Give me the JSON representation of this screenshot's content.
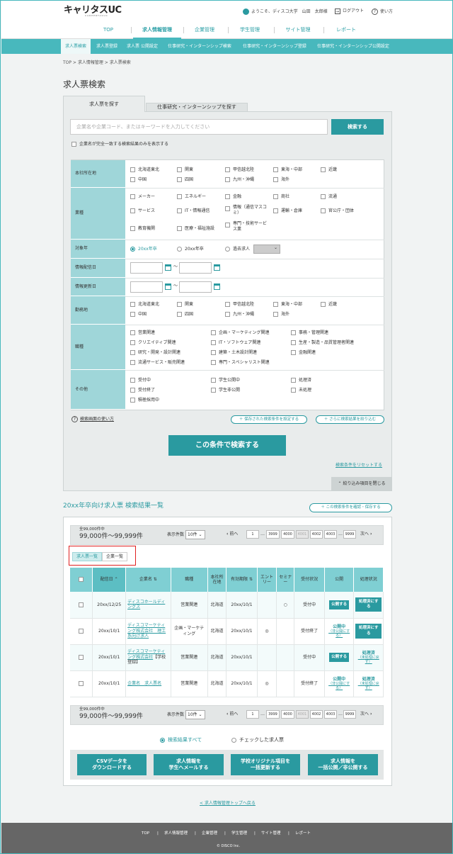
{
  "header": {
    "logo": "キャリタスUC",
    "logo_sub": "CAREERTASUC",
    "welcome": "ようこそ、ディスコ大学　山田　太郎様",
    "logout": "ログアウト",
    "help": "使い方"
  },
  "gnav": [
    "TOP",
    "求人情報管理",
    "企業管理",
    "学生管理",
    "サイト管理",
    "レポート"
  ],
  "subnav": [
    "求人票検索",
    "求人票登録",
    "求人票 公開設定",
    "仕事研究・インターンシップ検索",
    "仕事研究・インターンシップ登録",
    "仕事研究・インターンシップ公開設定"
  ],
  "breadcrumb": "TOP > 求人情報管理 > 求人票検索",
  "page_title": "求人票検索",
  "tabs": [
    "求人票を探す",
    "仕事研究・インターンシップを探す"
  ],
  "search": {
    "placeholder": "企業名や企業コード、またはキーワードを入力してください",
    "button": "検索する",
    "exact_match": "企業名が完全一致する検索結果のみを表示する"
  },
  "conditions": {
    "hq_label": "本社所在地",
    "regions": [
      "北海道東北",
      "関東",
      "甲信越北陸",
      "東海・中部",
      "近畿",
      "中国",
      "四国",
      "九州・沖縄",
      "海外"
    ],
    "industry_label": "業種",
    "industries": [
      "メーカー",
      "エネルギー",
      "金融",
      "商社",
      "流通",
      "サービス",
      "IT・情報通信",
      "情報（通信マスコミ）",
      "運輸・倉庫",
      "官公庁・団体",
      "教育機関",
      "医療・福祉施設",
      "専門・技術サービス業"
    ],
    "year_label": "対象年",
    "years": [
      "20xx年卒",
      "20xx年卒",
      "過去求人"
    ],
    "dist_label": "情報配信日",
    "upd_label": "情報更新日",
    "tilde": "〜",
    "work_label": "勤務地",
    "job_label": "職種",
    "jobs": [
      "営業関連",
      "企画・マーケティング関連",
      "事務・管理関連",
      "クリエイティブ関連",
      "IT・ソフトウェア関連",
      "生産・製造・品質管理者関連",
      "研究・開発・設計関連",
      "建築・土木設計関連",
      "金融関連",
      "流通サービス・販売関連",
      "専門・スペシャリスト関連"
    ],
    "other_label": "その他",
    "others": [
      "受付中",
      "学生公開中",
      "処理済",
      "受付終了",
      "学生非公開",
      "未処理",
      "積極採用中"
    ]
  },
  "how_to": "検索画面の使い方",
  "saved_cond": "保存された検索条件を設定する",
  "narrow": "さらに検索結果を絞り込む",
  "search_cond_btn": "この条件で検索する",
  "reset": "検索条件をリセットする",
  "collapse": "絞り込み項目を閉じる",
  "results": {
    "title": "20xx年卒向け求人票 検索結果一覧",
    "save_btn": "この検索条件を確認・保存する",
    "total_label": "全99,000件中",
    "range": "99,000件～99,999件",
    "per_page_label": "表示件数",
    "per_page": "10件",
    "prev": "前へ",
    "next": "次へ",
    "pages": [
      "1",
      "…",
      "3999",
      "4000",
      "4001",
      "4002",
      "4003",
      "…",
      "9999"
    ],
    "view_tabs": [
      "求人票一覧",
      "企業一覧"
    ],
    "columns": [
      "配信日",
      "企業名",
      "職種",
      "本社所在地",
      "有効期限",
      "エントリー",
      "セミナー",
      "受付状況",
      "公開",
      "処理状況"
    ],
    "rows": [
      {
        "date": "20xx/12/25",
        "company": "ディスコホールディングス",
        "job": "営業関連",
        "hq": "北海道",
        "expire": "20xx/10/1",
        "entry": "",
        "seminar": "○",
        "status": "受付中",
        "publish_btn": "公開する",
        "process_btn": "処理済にする"
      },
      {
        "date": "20xx/10/1",
        "company": "ディスコマーケティング株式会社　理工系向け求人",
        "job": "企画・マーケティング",
        "hq": "北海道",
        "expire": "20xx/10/1",
        "entry": "◎",
        "seminar": "",
        "status": "受付終了",
        "publish_text": "公開中",
        "publish_link": "（非公開にする）",
        "process_btn": "処理済にする"
      },
      {
        "date": "20xx/10/1",
        "company": "ディスコマーケティング株式会社",
        "company_extra": "【学校登録】",
        "job": "営業関連",
        "hq": "北海道",
        "expire": "20xx/10/1",
        "entry": "",
        "seminar": "",
        "status": "受付中",
        "publish_btn": "公開する",
        "process_text": "処理済",
        "process_link": "（未処理に戻す）"
      },
      {
        "date": "20xx/10/1",
        "company": "企業名　求人票名",
        "job": "営業関連",
        "hq": "北海道",
        "expire": "20xx/10/1",
        "entry": "◎",
        "seminar": "",
        "status": "受付終了",
        "publish_text": "公開中",
        "publish_link": "（非公開にする）",
        "process_text": "処理済",
        "process_link": "（未処理に戻す）"
      }
    ],
    "radio_all": "検索結果すべて",
    "radio_checked": "チェックした求人票",
    "actions": [
      "CSVデータを\nダウンロードする",
      "求人情報を\n学生へメールする",
      "学校オリジナル項目を\n一括更新する",
      "求人情報を\n一括公開／非公開する"
    ]
  },
  "back_link": "< 求人情報管理トップへ戻る",
  "footer": {
    "links": [
      "TOP",
      "求人情報管理",
      "企業管理",
      "学生管理",
      "サイト管理",
      "レポート"
    ],
    "copyright": "© DISCO Inc."
  },
  "colors": {
    "accent": "#2a9aa0",
    "header_bg": "#48b8bd",
    "highlight": "#e02020"
  }
}
